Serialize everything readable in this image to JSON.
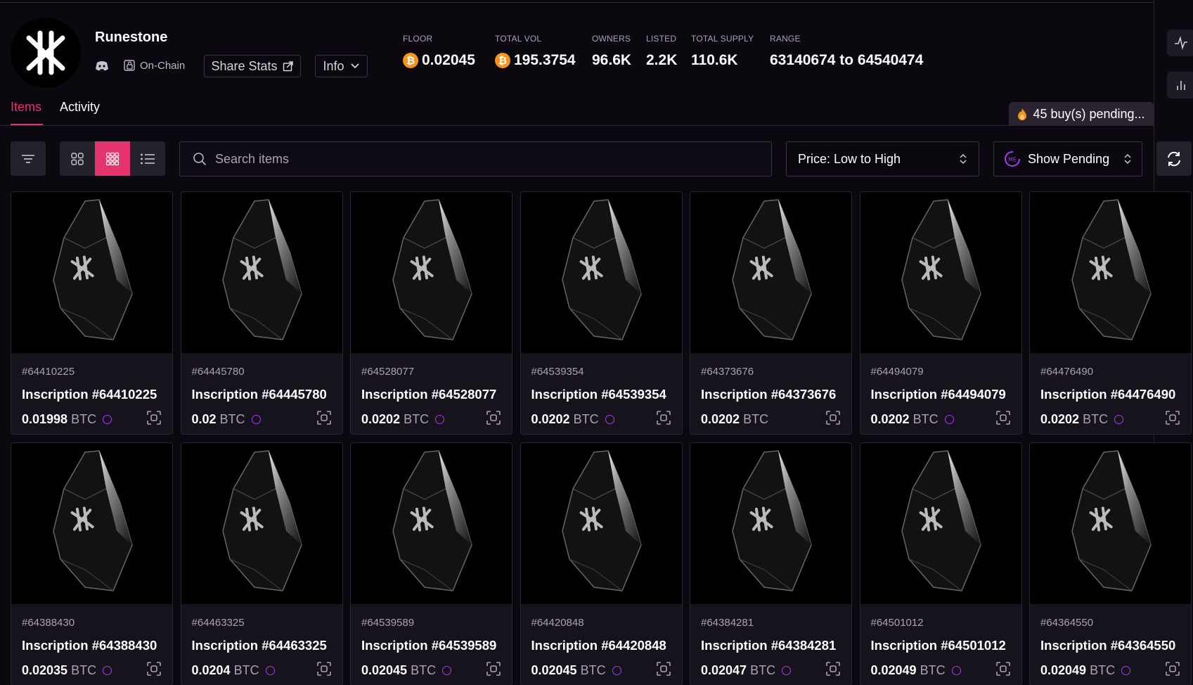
{
  "collection": {
    "name": "Runestone",
    "onchain_label": "On-Chain",
    "share_label": "Share Stats",
    "info_label": "Info"
  },
  "stats": [
    {
      "label": "FLOOR",
      "value": "0.02045",
      "btc": true
    },
    {
      "label": "TOTAL VOL",
      "value": "195.3754",
      "btc": true
    },
    {
      "label": "OWNERS",
      "value": "96.6K",
      "btc": false
    },
    {
      "label": "LISTED",
      "value": "2.2K",
      "btc": false
    },
    {
      "label": "TOTAL SUPPLY",
      "value": "110.6K",
      "btc": false
    },
    {
      "label": "RANGE",
      "value": "63140674 to 64540474",
      "btc": false
    }
  ],
  "tabs": {
    "items": "Items",
    "activity": "Activity"
  },
  "pending_banner": "45 buy(s) pending...",
  "toolbar": {
    "search_placeholder": "Search items",
    "sort_value": "Price: Low to High",
    "pending_filter": "Show Pending"
  },
  "currency": "BTC",
  "items": [
    {
      "id": "#64410225",
      "title": "Inscription #64410225",
      "price": "0.01998",
      "me": true
    },
    {
      "id": "#64445780",
      "title": "Inscription #64445780",
      "price": "0.02",
      "me": true
    },
    {
      "id": "#64528077",
      "title": "Inscription #64528077",
      "price": "0.0202",
      "me": true
    },
    {
      "id": "#64539354",
      "title": "Inscription #64539354",
      "price": "0.0202",
      "me": true
    },
    {
      "id": "#64373676",
      "title": "Inscription #64373676",
      "price": "0.0202",
      "me": false
    },
    {
      "id": "#64494079",
      "title": "Inscription #64494079",
      "price": "0.0202",
      "me": true
    },
    {
      "id": "#64476490",
      "title": "Inscription #64476490",
      "price": "0.0202",
      "me": true
    },
    {
      "id": "#64388430",
      "title": "Inscription #64388430",
      "price": "0.02035",
      "me": true
    },
    {
      "id": "#64463325",
      "title": "Inscription #64463325",
      "price": "0.0204",
      "me": true
    },
    {
      "id": "#64539589",
      "title": "Inscription #64539589",
      "price": "0.02045",
      "me": true
    },
    {
      "id": "#64420848",
      "title": "Inscription #64420848",
      "price": "0.02045",
      "me": true
    },
    {
      "id": "#64384281",
      "title": "Inscription #64384281",
      "price": "0.02047",
      "me": true
    },
    {
      "id": "#64501012",
      "title": "Inscription #64501012",
      "price": "0.02049",
      "me": true
    },
    {
      "id": "#64364550",
      "title": "Inscription #64364550",
      "price": "0.02049",
      "me": true
    }
  ],
  "colors": {
    "accent": "#e5336e",
    "btc": "#f7931a",
    "magic_eden": "#a23cf0",
    "background": "#0b080f"
  }
}
